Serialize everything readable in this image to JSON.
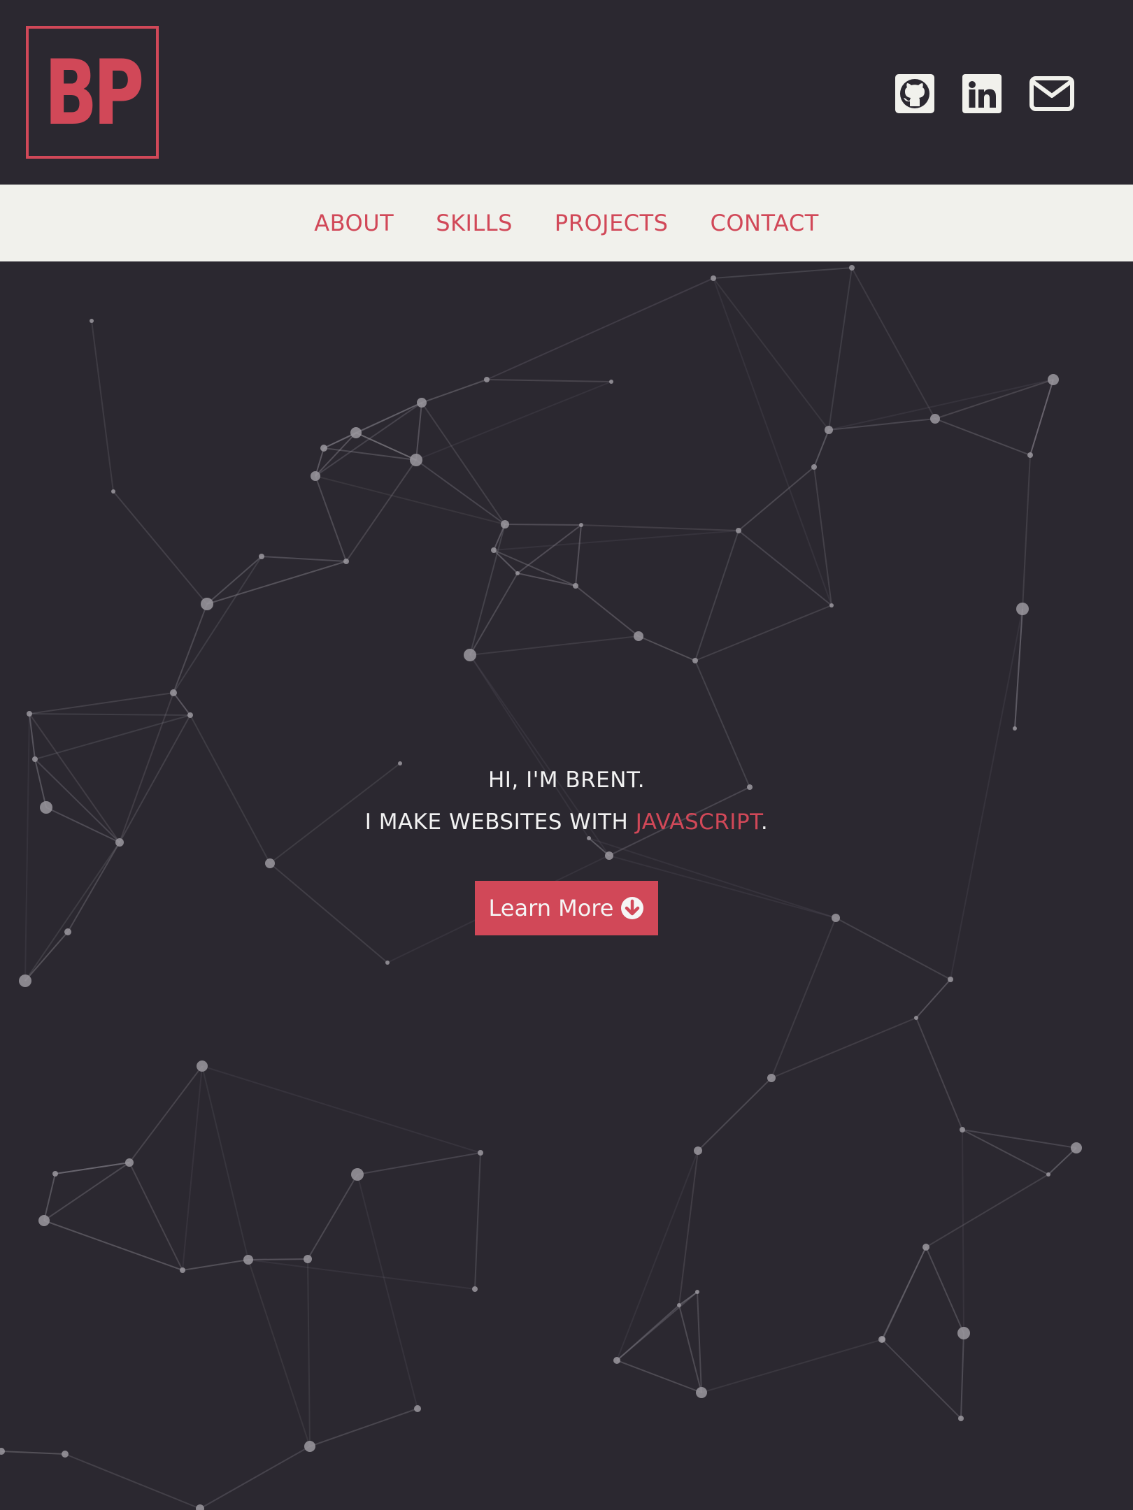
{
  "header": {
    "logo_text": "BP",
    "social": [
      {
        "name": "github-icon"
      },
      {
        "name": "linkedin-icon"
      },
      {
        "name": "email-icon"
      }
    ]
  },
  "nav": {
    "items": [
      {
        "label": "ABOUT"
      },
      {
        "label": "SKILLS"
      },
      {
        "label": "PROJECTS"
      },
      {
        "label": "CONTACT"
      }
    ]
  },
  "hero": {
    "line1": "HI, I'M BRENT.",
    "line2_prefix": "I MAKE WEBSITES WITH ",
    "line2_highlight": "JAVASCRIPT",
    "line2_suffix": ".",
    "cta_label": "Learn More",
    "cta_icon": "arrow-down-circle-icon"
  },
  "colors": {
    "background": "#2b2830",
    "nav_background": "#f1f1ec",
    "accent": "#d14858",
    "text": "#f2f2f2",
    "network": "#8a8790"
  }
}
